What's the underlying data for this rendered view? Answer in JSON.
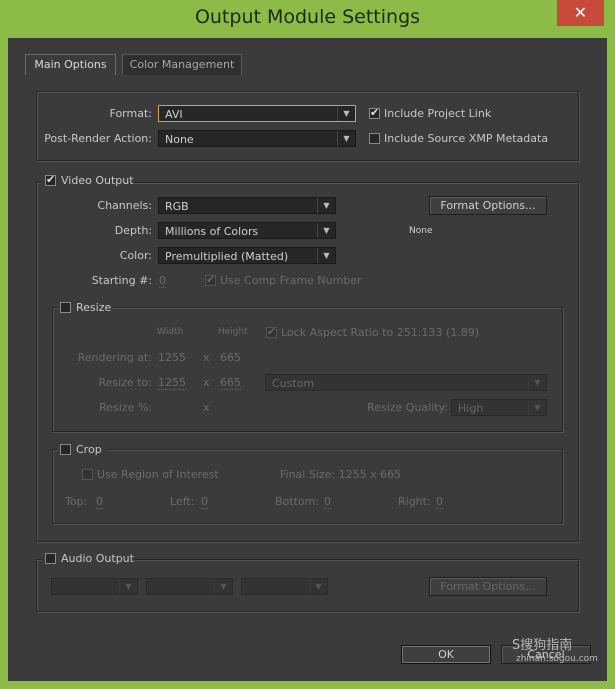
{
  "window": {
    "title": "Output Module Settings",
    "close_glyph": "✕"
  },
  "tabs": [
    {
      "label": "Main Options"
    },
    {
      "label": "Color Management"
    }
  ],
  "main": {
    "format_label": "Format:",
    "format_value": "AVI",
    "include_project_link": "Include Project Link",
    "post_render_label": "Post-Render Action:",
    "post_render_value": "None",
    "include_xmp": "Include Source XMP Metadata"
  },
  "video": {
    "section_label": "Video Output",
    "channels_label": "Channels:",
    "channels_value": "RGB",
    "depth_label": "Depth:",
    "depth_value": "Millions of Colors",
    "color_label": "Color:",
    "color_value": "Premultiplied (Matted)",
    "starting_label": "Starting #:",
    "starting_value": "0",
    "use_comp_frame": "Use Comp Frame Number",
    "format_options_button": "Format Options...",
    "format_options_summary": "None"
  },
  "resize": {
    "section_label": "Resize",
    "width_header": "Width",
    "height_header": "Height",
    "lock_aspect": "Lock Aspect Ratio to 251:133 (1.89)",
    "rendering_label": "Rendering at:",
    "rendering_w": "1255",
    "x1": "x",
    "rendering_h": "665",
    "resize_to_label": "Resize to:",
    "resize_to_w": "1255",
    "x2": "x",
    "resize_to_h": "665",
    "preset_value": "Custom",
    "resize_pct_label": "Resize %:",
    "x3": "x",
    "quality_label": "Resize Quality:",
    "quality_value": "High"
  },
  "crop": {
    "section_label": "Crop",
    "use_roi": "Use Region of Interest",
    "final_size": "Final Size: 1255 x 665",
    "top_label": "Top:",
    "top_value": "0",
    "left_label": "Left:",
    "left_value": "0",
    "bottom_label": "Bottom:",
    "bottom_value": "0",
    "right_label": "Right:",
    "right_value": "0"
  },
  "audio": {
    "section_label": "Audio Output",
    "format_options_button": "Format Options..."
  },
  "footer": {
    "ok_button": "OK",
    "cancel_button": "Cancel"
  },
  "watermark": {
    "brand": "S搜狗指南",
    "url": "zhinan.sogou.com"
  }
}
